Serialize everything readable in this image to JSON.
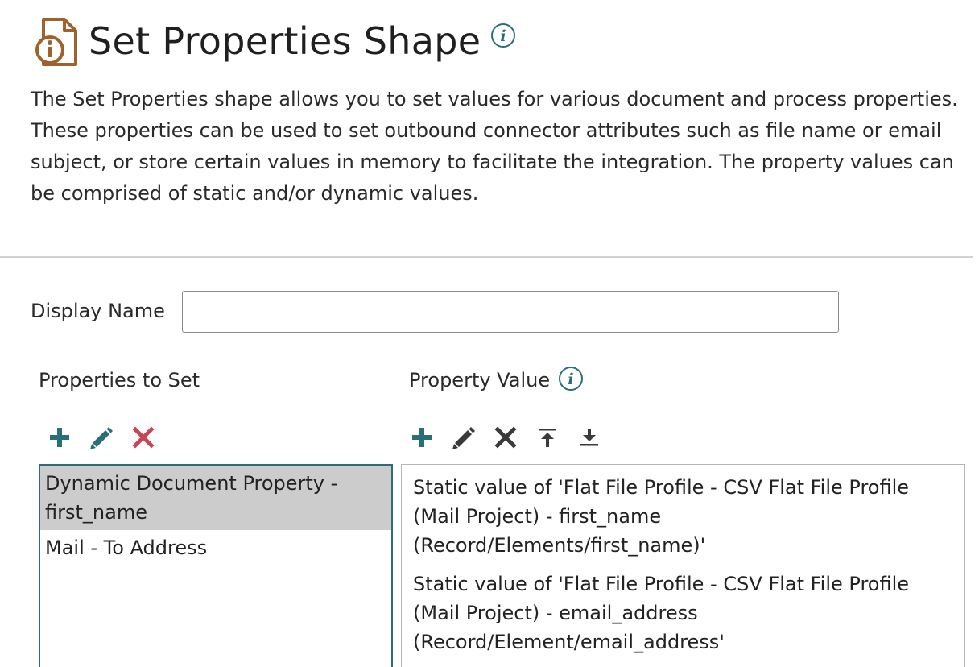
{
  "header": {
    "title": "Set Properties Shape",
    "icon": "document-info-icon",
    "info_icon": "info-icon"
  },
  "description": "The Set Properties shape allows you to set values for various document and process properties. These properties can be used to set outbound connector attributes such as file name or email subject, or store certain values in memory to facilitate the integration. The property values can be comprised of static and/or dynamic values.",
  "display_name": {
    "label": "Display Name",
    "value": "",
    "placeholder": ""
  },
  "properties_to_set": {
    "label": "Properties to Set",
    "toolbar": [
      "add-icon",
      "edit-icon",
      "delete-icon"
    ],
    "items": [
      {
        "label": "Dynamic Document Property - first_name",
        "selected": true
      },
      {
        "label": "Mail - To Address",
        "selected": false
      }
    ]
  },
  "property_value": {
    "label": "Property Value",
    "info_icon": "info-icon",
    "toolbar": [
      "add-icon",
      "edit-icon",
      "delete-icon",
      "move-top-icon",
      "move-bottom-icon"
    ],
    "items": [
      {
        "label": "Static value of 'Flat File Profile - CSV Flat File Profile (Mail Project) - first_name (Record/Elements/first_name)'"
      },
      {
        "label": "Static value of 'Flat File Profile - CSV Flat File Profile (Mail Project) - email_address (Record/Element/email_address'"
      }
    ]
  },
  "colors": {
    "teal": "#2a6f78",
    "delete_red": "#c94556",
    "icon_brown": "#a0622d",
    "icon_dark": "#3a3a3a"
  }
}
